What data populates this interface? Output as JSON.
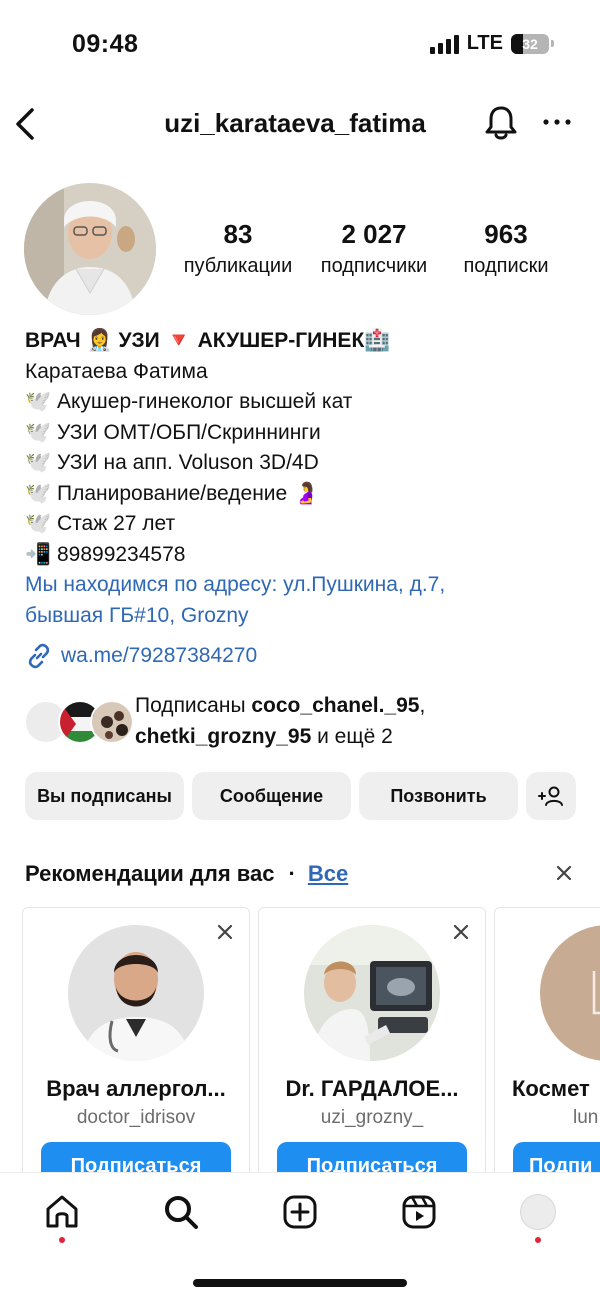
{
  "status_bar": {
    "time": "09:48",
    "network": "LTE",
    "battery": "32"
  },
  "header": {
    "username": "uzi_karataeva_fatima"
  },
  "profile": {
    "stats": [
      {
        "value": "83",
        "label": "публикации"
      },
      {
        "value": "2 027",
        "label": "подписчики"
      },
      {
        "value": "963",
        "label": "подписки"
      }
    ],
    "bio": {
      "title": "ВРАЧ 👩‍⚕️ УЗИ 🔻 АКУШЕР-ГИНЕК🏥",
      "name": "Каратаева Фатима",
      "lines": [
        "🕊️ Акушер-гинеколог высшей кат",
        "🕊️ УЗИ ОМТ/ОБП/Скриннинги",
        "🕊️ УЗИ на апп. Voluson 3D/4D",
        "🕊️ Планирование/ведение 🤰",
        "🕊️ Стаж 27 лет",
        "📲 89899234578"
      ],
      "address_line1": "Мы находимся по адресу: ул.Пушкина, д.7,",
      "address_line2": "бывшая ГБ#10, Grozny"
    },
    "link": "wa.me/79287384270",
    "followed_by": {
      "prefix": "Подписаны ",
      "user1": "coco_chanel._95",
      "comma": ",",
      "user2": "chetki_grozny_95",
      "suffix": " и ещё 2"
    }
  },
  "actions": {
    "following": "Вы подписаны",
    "message": "Сообщение",
    "call": "Позвонить"
  },
  "recommendations": {
    "title": "Рекомендации для вас",
    "dot": "·",
    "see_all": "Все",
    "cards": [
      {
        "name": "Врач аллергол...",
        "username": "doctor_idrisov",
        "button": "Подписаться"
      },
      {
        "name": "Dr. ГАРДАЛОЕ...",
        "username": "uzi_grozny_",
        "button": "Подписаться"
      },
      {
        "name": "Космет",
        "username": "lun",
        "button": "Подпи"
      }
    ]
  },
  "colors": {
    "link": "#2f68b5",
    "follow_button": "#1e8ef0",
    "secondary_button": "#efefef",
    "notification_dot": "#e0243a"
  }
}
